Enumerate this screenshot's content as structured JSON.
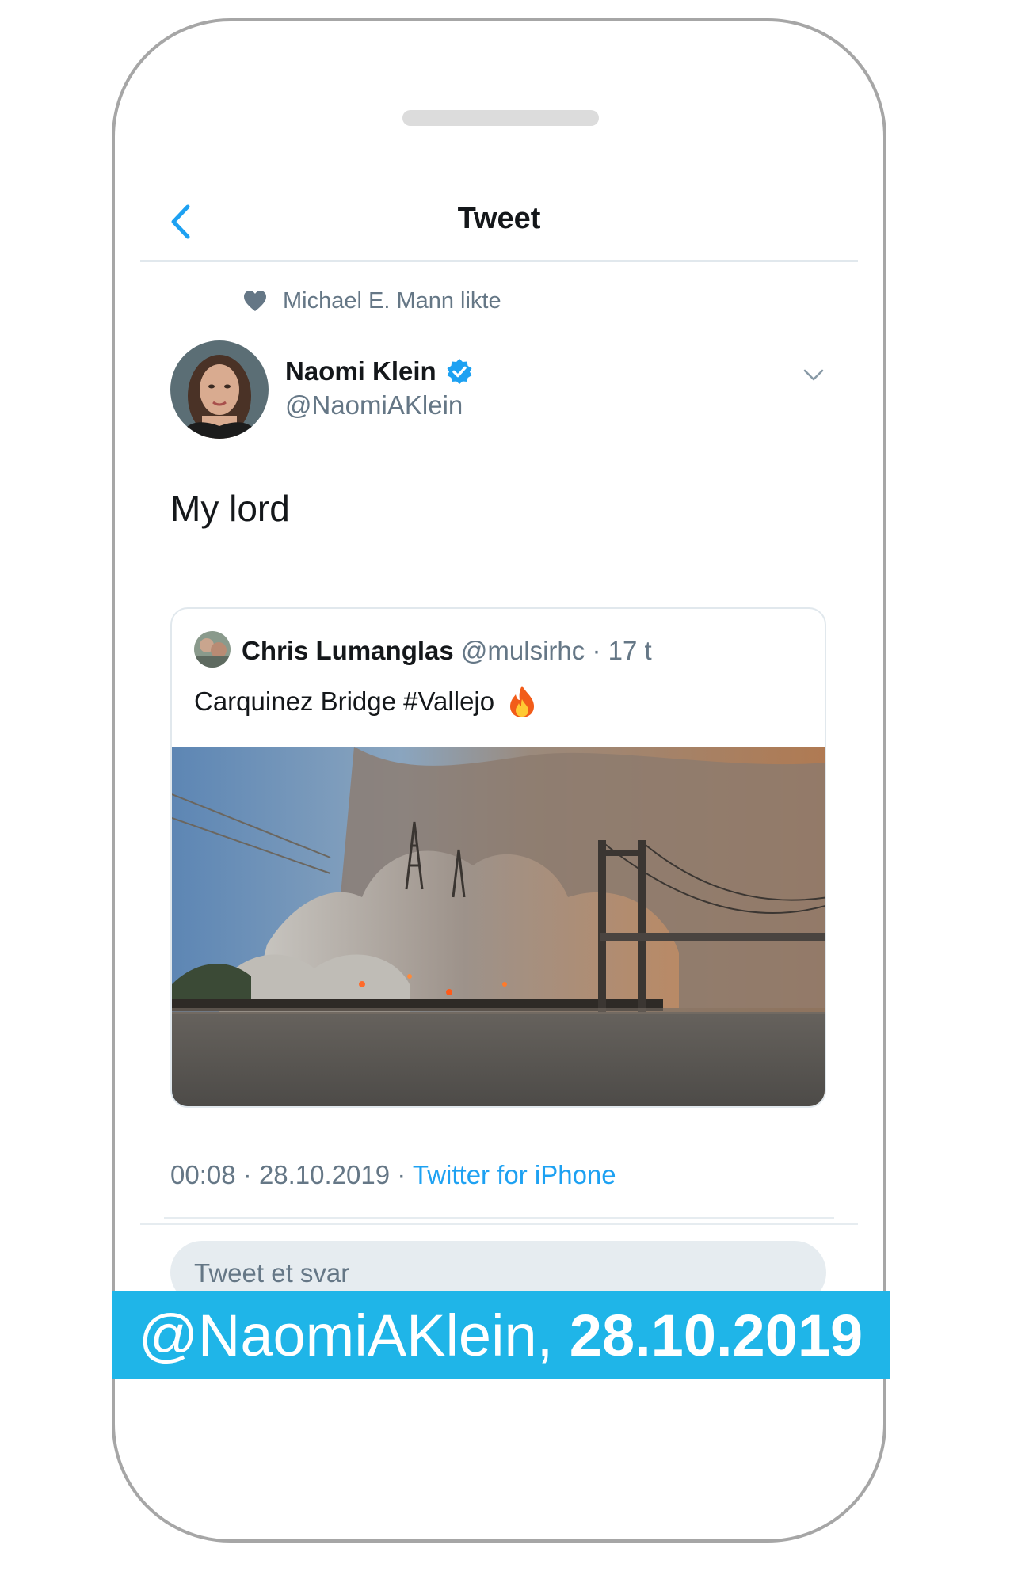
{
  "nav": {
    "title": "Tweet",
    "back_icon": "chevron-left-icon"
  },
  "liked_by": {
    "icon": "heart-icon",
    "text": "Michael E. Mann likte"
  },
  "tweet": {
    "author_name": "Naomi Klein",
    "author_handle": "@NaomiAKlein",
    "verified": true,
    "text": "My lord",
    "time": "00:08",
    "separator_1": "·",
    "date": "28.10.2019",
    "separator_2": "·",
    "source": "Twitter for iPhone"
  },
  "quoted_tweet": {
    "author_name": "Chris Lumanglas",
    "author_handle": "@mulsirhc",
    "separator": "·",
    "age": "17 t",
    "text": "Carquinez Bridge #Vallejo",
    "emoji_icon": "fire-icon"
  },
  "reply": {
    "placeholder": "Tweet et svar"
  },
  "caption": {
    "handle": "@NaomiAKlein,",
    "date": "28.10.2019"
  },
  "colors": {
    "accent": "#1da1f2",
    "caption_banner": "#1fb5e8",
    "secondary_text": "#657786",
    "primary_text": "#14171a"
  }
}
